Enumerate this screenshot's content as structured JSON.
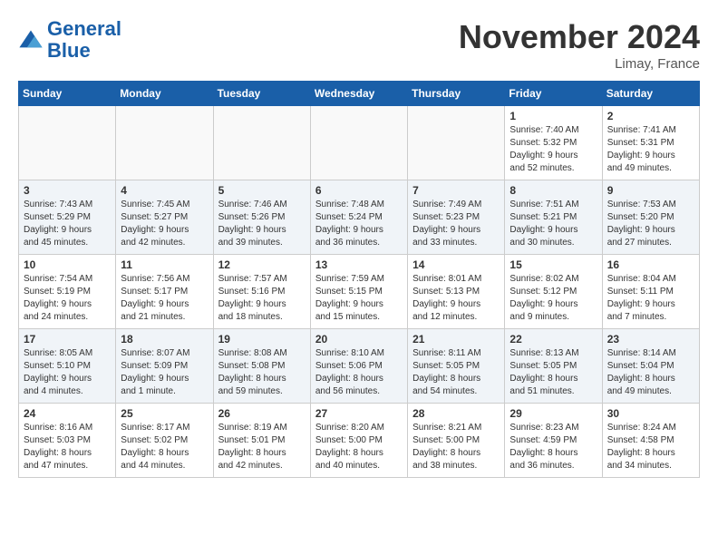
{
  "logo": {
    "text_general": "General",
    "text_blue": "Blue"
  },
  "title": "November 2024",
  "location": "Limay, France",
  "days_of_week": [
    "Sunday",
    "Monday",
    "Tuesday",
    "Wednesday",
    "Thursday",
    "Friday",
    "Saturday"
  ],
  "weeks": [
    [
      {
        "day": "",
        "info": ""
      },
      {
        "day": "",
        "info": ""
      },
      {
        "day": "",
        "info": ""
      },
      {
        "day": "",
        "info": ""
      },
      {
        "day": "",
        "info": ""
      },
      {
        "day": "1",
        "info": "Sunrise: 7:40 AM\nSunset: 5:32 PM\nDaylight: 9 hours\nand 52 minutes."
      },
      {
        "day": "2",
        "info": "Sunrise: 7:41 AM\nSunset: 5:31 PM\nDaylight: 9 hours\nand 49 minutes."
      }
    ],
    [
      {
        "day": "3",
        "info": "Sunrise: 7:43 AM\nSunset: 5:29 PM\nDaylight: 9 hours\nand 45 minutes."
      },
      {
        "day": "4",
        "info": "Sunrise: 7:45 AM\nSunset: 5:27 PM\nDaylight: 9 hours\nand 42 minutes."
      },
      {
        "day": "5",
        "info": "Sunrise: 7:46 AM\nSunset: 5:26 PM\nDaylight: 9 hours\nand 39 minutes."
      },
      {
        "day": "6",
        "info": "Sunrise: 7:48 AM\nSunset: 5:24 PM\nDaylight: 9 hours\nand 36 minutes."
      },
      {
        "day": "7",
        "info": "Sunrise: 7:49 AM\nSunset: 5:23 PM\nDaylight: 9 hours\nand 33 minutes."
      },
      {
        "day": "8",
        "info": "Sunrise: 7:51 AM\nSunset: 5:21 PM\nDaylight: 9 hours\nand 30 minutes."
      },
      {
        "day": "9",
        "info": "Sunrise: 7:53 AM\nSunset: 5:20 PM\nDaylight: 9 hours\nand 27 minutes."
      }
    ],
    [
      {
        "day": "10",
        "info": "Sunrise: 7:54 AM\nSunset: 5:19 PM\nDaylight: 9 hours\nand 24 minutes."
      },
      {
        "day": "11",
        "info": "Sunrise: 7:56 AM\nSunset: 5:17 PM\nDaylight: 9 hours\nand 21 minutes."
      },
      {
        "day": "12",
        "info": "Sunrise: 7:57 AM\nSunset: 5:16 PM\nDaylight: 9 hours\nand 18 minutes."
      },
      {
        "day": "13",
        "info": "Sunrise: 7:59 AM\nSunset: 5:15 PM\nDaylight: 9 hours\nand 15 minutes."
      },
      {
        "day": "14",
        "info": "Sunrise: 8:01 AM\nSunset: 5:13 PM\nDaylight: 9 hours\nand 12 minutes."
      },
      {
        "day": "15",
        "info": "Sunrise: 8:02 AM\nSunset: 5:12 PM\nDaylight: 9 hours\nand 9 minutes."
      },
      {
        "day": "16",
        "info": "Sunrise: 8:04 AM\nSunset: 5:11 PM\nDaylight: 9 hours\nand 7 minutes."
      }
    ],
    [
      {
        "day": "17",
        "info": "Sunrise: 8:05 AM\nSunset: 5:10 PM\nDaylight: 9 hours\nand 4 minutes."
      },
      {
        "day": "18",
        "info": "Sunrise: 8:07 AM\nSunset: 5:09 PM\nDaylight: 9 hours\nand 1 minute."
      },
      {
        "day": "19",
        "info": "Sunrise: 8:08 AM\nSunset: 5:08 PM\nDaylight: 8 hours\nand 59 minutes."
      },
      {
        "day": "20",
        "info": "Sunrise: 8:10 AM\nSunset: 5:06 PM\nDaylight: 8 hours\nand 56 minutes."
      },
      {
        "day": "21",
        "info": "Sunrise: 8:11 AM\nSunset: 5:05 PM\nDaylight: 8 hours\nand 54 minutes."
      },
      {
        "day": "22",
        "info": "Sunrise: 8:13 AM\nSunset: 5:05 PM\nDaylight: 8 hours\nand 51 minutes."
      },
      {
        "day": "23",
        "info": "Sunrise: 8:14 AM\nSunset: 5:04 PM\nDaylight: 8 hours\nand 49 minutes."
      }
    ],
    [
      {
        "day": "24",
        "info": "Sunrise: 8:16 AM\nSunset: 5:03 PM\nDaylight: 8 hours\nand 47 minutes."
      },
      {
        "day": "25",
        "info": "Sunrise: 8:17 AM\nSunset: 5:02 PM\nDaylight: 8 hours\nand 44 minutes."
      },
      {
        "day": "26",
        "info": "Sunrise: 8:19 AM\nSunset: 5:01 PM\nDaylight: 8 hours\nand 42 minutes."
      },
      {
        "day": "27",
        "info": "Sunrise: 8:20 AM\nSunset: 5:00 PM\nDaylight: 8 hours\nand 40 minutes."
      },
      {
        "day": "28",
        "info": "Sunrise: 8:21 AM\nSunset: 5:00 PM\nDaylight: 8 hours\nand 38 minutes."
      },
      {
        "day": "29",
        "info": "Sunrise: 8:23 AM\nSunset: 4:59 PM\nDaylight: 8 hours\nand 36 minutes."
      },
      {
        "day": "30",
        "info": "Sunrise: 8:24 AM\nSunset: 4:58 PM\nDaylight: 8 hours\nand 34 minutes."
      }
    ]
  ]
}
